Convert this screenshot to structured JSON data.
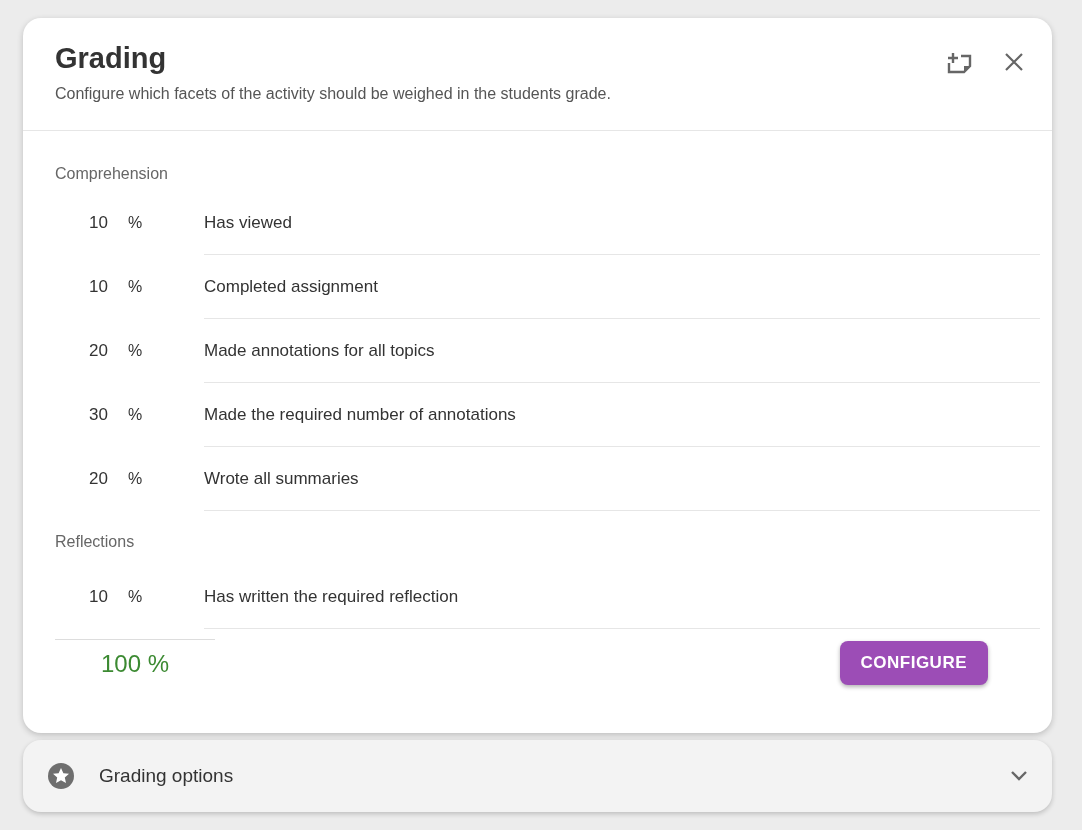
{
  "dialog": {
    "title": "Grading",
    "subtitle": "Configure which facets of the activity should be weighed in the students grade."
  },
  "sections": [
    {
      "title": "Comprehension",
      "rows": [
        {
          "percent": "10",
          "unit": "%",
          "label": "Has viewed"
        },
        {
          "percent": "10",
          "unit": "%",
          "label": "Completed assignment"
        },
        {
          "percent": "20",
          "unit": "%",
          "label": "Made annotations for all topics"
        },
        {
          "percent": "30",
          "unit": "%",
          "label": "Made the required number of annotations"
        },
        {
          "percent": "20",
          "unit": "%",
          "label": "Wrote all summaries"
        }
      ]
    },
    {
      "title": "Reflections",
      "rows": [
        {
          "percent": "10",
          "unit": "%",
          "label": "Has written the required reflection"
        }
      ]
    }
  ],
  "total": "100 %",
  "configure_button": "CONFIGURE",
  "options_panel": {
    "title": "Grading options",
    "expanded": false
  }
}
